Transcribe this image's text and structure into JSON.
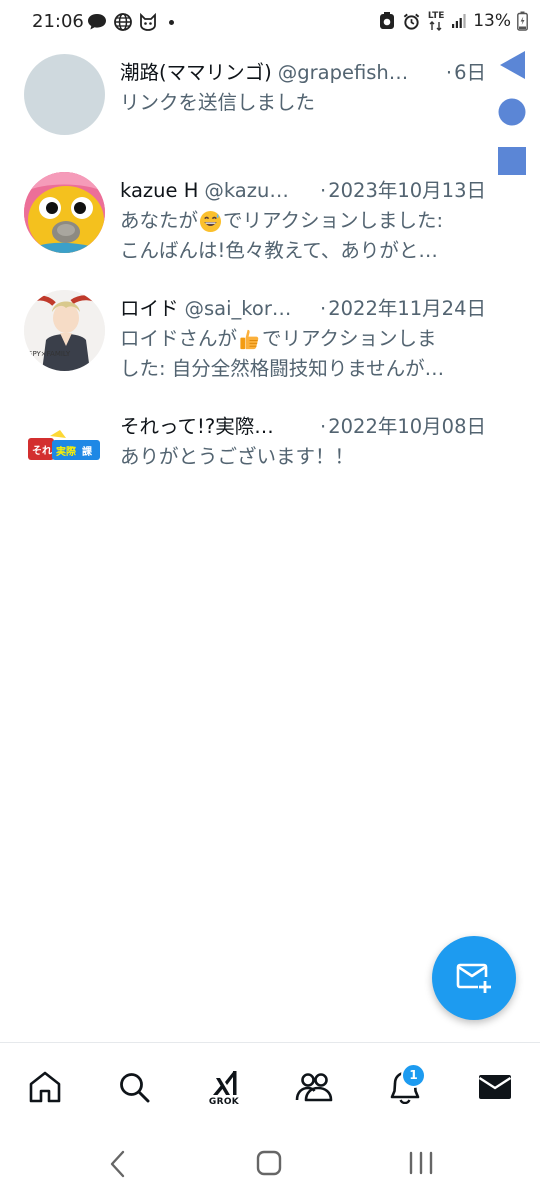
{
  "status_bar": {
    "time": "21:06",
    "battery_percent": "13%",
    "network": "LTE",
    "notification_icons": [
      "chat-bubble-icon",
      "globe-icon",
      "cat-app-icon",
      "more-dot-icon"
    ],
    "system_icons": [
      "alarm-icon",
      "lte-icon",
      "signal-icon",
      "battery-icon"
    ]
  },
  "side_controls": {
    "accent": "#5b86d6",
    "icons": [
      "triangle-back-icon",
      "circle-home-icon",
      "square-recents-icon"
    ]
  },
  "conversations": [
    {
      "name": "潮路(ママリンゴ)",
      "handle": "@grapefish…",
      "separator": "·",
      "date": "6日",
      "preview_lines": [
        "リンクを送信しました"
      ],
      "avatar": "default-gray"
    },
    {
      "name": "kazue H",
      "handle": "@kazu…",
      "separator": "·",
      "date": "2023年10月13日",
      "preview_before_emoji": "あなたが",
      "preview_after_emoji": "でリアクションしました:",
      "preview_line2": "こんばんは!色々教えて、ありがと…",
      "emoji": "grinning-sweat-face-emoji",
      "avatar": "yellow-knit-bird"
    },
    {
      "name": "ロイド",
      "handle": "@sai_kor…",
      "separator": "·",
      "date": "2022年11月24日",
      "preview_before_emoji": "ロイドさんが",
      "preview_after_emoji": "でリアクションしま",
      "preview_line2": "した: 自分全然格闘技知りませんが…",
      "emoji": "thumbs-up-emoji",
      "avatar": "anime-character",
      "avatar_text": "SPY×FAMILY"
    },
    {
      "name": "それって!?実際…",
      "handle": "",
      "separator": "·",
      "date": "2022年10月08日",
      "preview_lines": [
        "ありがとうございます！！"
      ],
      "avatar": "tv-show-logo",
      "avatar_text": "それって!?実際どうなの課"
    }
  ],
  "fab": {
    "icon": "new-message-icon",
    "color": "#1d9bf0"
  },
  "bottom_nav": {
    "items": [
      "home-icon",
      "search-icon",
      "grok-icon",
      "communities-icon",
      "notifications-icon",
      "messages-icon"
    ],
    "grok_label": "GROK",
    "notification_badge": "1",
    "active": "messages"
  },
  "system_nav": [
    "back-icon",
    "home-icon",
    "recents-icon"
  ]
}
